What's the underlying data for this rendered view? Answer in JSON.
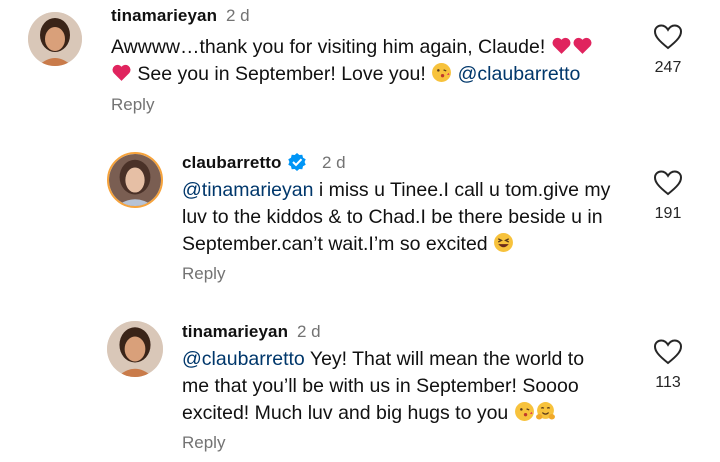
{
  "comments": [
    {
      "username": "tinamarieyan",
      "time": "2 d",
      "text_parts": {
        "a": "Awwww…thank you for visiting him again, Claude!",
        "b": "See you in September!  Love you!",
        "mention": "@claubarretto"
      },
      "reply_label": "Reply",
      "likes": "247",
      "avatar_icon": "tinamarieyan-avatar"
    },
    {
      "username": "claubarretto",
      "verified": true,
      "time": "2 d",
      "text_parts": {
        "mention": "@tinamarieyan",
        "a": " i miss u Tinee.I call u tom.give my",
        "b": "luv to the kiddos & to Chad.I be there beside u in",
        "c": "September.can’t wait.I’m so excited"
      },
      "reply_label": "Reply",
      "likes": "191",
      "avatar_icon": "claubarretto-avatar"
    },
    {
      "username": "tinamarieyan",
      "time": "2 d",
      "text_parts": {
        "mention": "@claubarretto",
        "a": " Yey!  That will mean the world to",
        "b": "me that you’ll be with us in September!  Soooo",
        "c": "excited!  Much luv and big hugs to you"
      },
      "reply_label": "Reply",
      "likes": "113",
      "avatar_icon": "tinamarieyan-avatar"
    }
  ],
  "colors": {
    "text": "#111111",
    "muted": "#737373",
    "mention": "#00376b",
    "heart_emoji": "#e0245e",
    "verified": "#0095f6"
  }
}
